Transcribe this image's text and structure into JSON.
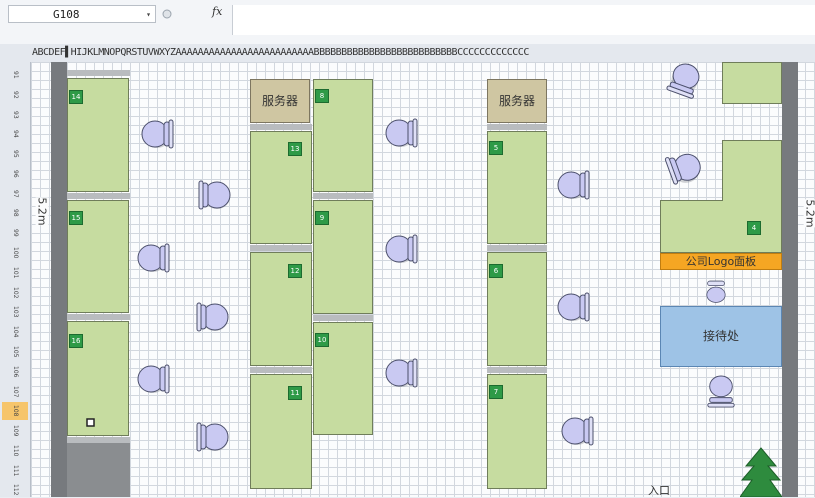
{
  "formula_bar": {
    "name_box": "G108",
    "name_box_arrow": "▾",
    "fx_label": "fx",
    "formula_value": ""
  },
  "column_header_text": "ABCDEF▌HIJKLMNOPQRSTUVWXYZAAAAAAAAAAAAAAAAAAAAAAAAABBBBBBBBBBBBBBBBBBBBBBBBBBCCCCCCCCCCCCC",
  "selected_row": "108",
  "row_labels": [
    "91",
    "92",
    "93",
    "94",
    "95",
    "96",
    "97",
    "98",
    "99",
    "100",
    "101",
    "102",
    "103",
    "104",
    "105",
    "106",
    "107",
    "108",
    "109",
    "110",
    "111",
    "112"
  ],
  "floor_plan": {
    "servers": [
      {
        "label": "服务器"
      },
      {
        "label": "服务器"
      }
    ],
    "desk_numbers": [
      "14",
      "15",
      "16",
      "8",
      "13",
      "9",
      "12",
      "10",
      "11",
      "5",
      "6",
      "7",
      "4"
    ],
    "logo_board": "公司Logo面板",
    "reception": "接待处",
    "dimension_left": "5.2m",
    "dimension_right": "5.2m",
    "entrance": "入口"
  },
  "colors": {
    "desk": "#c6dca0",
    "number_badge": "#2e9a47",
    "server": "#cfc6a2",
    "logo_board": "#f5a623",
    "reception": "#9ec3e6",
    "chair": "#c9c9f2",
    "wall": "#777a7e",
    "tree": "#2e8b3e"
  }
}
